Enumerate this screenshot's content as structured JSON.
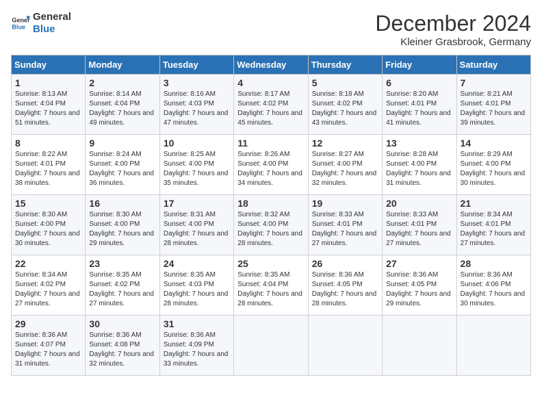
{
  "header": {
    "logo_line1": "General",
    "logo_line2": "Blue",
    "month": "December 2024",
    "location": "Kleiner Grasbrook, Germany"
  },
  "days_of_week": [
    "Sunday",
    "Monday",
    "Tuesday",
    "Wednesday",
    "Thursday",
    "Friday",
    "Saturday"
  ],
  "weeks": [
    [
      {
        "day": "1",
        "info": "Sunrise: 8:13 AM\nSunset: 4:04 PM\nDaylight: 7 hours\nand 51 minutes."
      },
      {
        "day": "2",
        "info": "Sunrise: 8:14 AM\nSunset: 4:04 PM\nDaylight: 7 hours\nand 49 minutes."
      },
      {
        "day": "3",
        "info": "Sunrise: 8:16 AM\nSunset: 4:03 PM\nDaylight: 7 hours\nand 47 minutes."
      },
      {
        "day": "4",
        "info": "Sunrise: 8:17 AM\nSunset: 4:02 PM\nDaylight: 7 hours\nand 45 minutes."
      },
      {
        "day": "5",
        "info": "Sunrise: 8:18 AM\nSunset: 4:02 PM\nDaylight: 7 hours\nand 43 minutes."
      },
      {
        "day": "6",
        "info": "Sunrise: 8:20 AM\nSunset: 4:01 PM\nDaylight: 7 hours\nand 41 minutes."
      },
      {
        "day": "7",
        "info": "Sunrise: 8:21 AM\nSunset: 4:01 PM\nDaylight: 7 hours\nand 39 minutes."
      }
    ],
    [
      {
        "day": "8",
        "info": "Sunrise: 8:22 AM\nSunset: 4:01 PM\nDaylight: 7 hours\nand 38 minutes."
      },
      {
        "day": "9",
        "info": "Sunrise: 8:24 AM\nSunset: 4:00 PM\nDaylight: 7 hours\nand 36 minutes."
      },
      {
        "day": "10",
        "info": "Sunrise: 8:25 AM\nSunset: 4:00 PM\nDaylight: 7 hours\nand 35 minutes."
      },
      {
        "day": "11",
        "info": "Sunrise: 8:26 AM\nSunset: 4:00 PM\nDaylight: 7 hours\nand 34 minutes."
      },
      {
        "day": "12",
        "info": "Sunrise: 8:27 AM\nSunset: 4:00 PM\nDaylight: 7 hours\nand 32 minutes."
      },
      {
        "day": "13",
        "info": "Sunrise: 8:28 AM\nSunset: 4:00 PM\nDaylight: 7 hours\nand 31 minutes."
      },
      {
        "day": "14",
        "info": "Sunrise: 8:29 AM\nSunset: 4:00 PM\nDaylight: 7 hours\nand 30 minutes."
      }
    ],
    [
      {
        "day": "15",
        "info": "Sunrise: 8:30 AM\nSunset: 4:00 PM\nDaylight: 7 hours\nand 30 minutes."
      },
      {
        "day": "16",
        "info": "Sunrise: 8:30 AM\nSunset: 4:00 PM\nDaylight: 7 hours\nand 29 minutes."
      },
      {
        "day": "17",
        "info": "Sunrise: 8:31 AM\nSunset: 4:00 PM\nDaylight: 7 hours\nand 28 minutes."
      },
      {
        "day": "18",
        "info": "Sunrise: 8:32 AM\nSunset: 4:00 PM\nDaylight: 7 hours\nand 28 minutes."
      },
      {
        "day": "19",
        "info": "Sunrise: 8:33 AM\nSunset: 4:01 PM\nDaylight: 7 hours\nand 27 minutes."
      },
      {
        "day": "20",
        "info": "Sunrise: 8:33 AM\nSunset: 4:01 PM\nDaylight: 7 hours\nand 27 minutes."
      },
      {
        "day": "21",
        "info": "Sunrise: 8:34 AM\nSunset: 4:01 PM\nDaylight: 7 hours\nand 27 minutes."
      }
    ],
    [
      {
        "day": "22",
        "info": "Sunrise: 8:34 AM\nSunset: 4:02 PM\nDaylight: 7 hours\nand 27 minutes."
      },
      {
        "day": "23",
        "info": "Sunrise: 8:35 AM\nSunset: 4:02 PM\nDaylight: 7 hours\nand 27 minutes."
      },
      {
        "day": "24",
        "info": "Sunrise: 8:35 AM\nSunset: 4:03 PM\nDaylight: 7 hours\nand 28 minutes."
      },
      {
        "day": "25",
        "info": "Sunrise: 8:35 AM\nSunset: 4:04 PM\nDaylight: 7 hours\nand 28 minutes."
      },
      {
        "day": "26",
        "info": "Sunrise: 8:36 AM\nSunset: 4:05 PM\nDaylight: 7 hours\nand 28 minutes."
      },
      {
        "day": "27",
        "info": "Sunrise: 8:36 AM\nSunset: 4:05 PM\nDaylight: 7 hours\nand 29 minutes."
      },
      {
        "day": "28",
        "info": "Sunrise: 8:36 AM\nSunset: 4:06 PM\nDaylight: 7 hours\nand 30 minutes."
      }
    ],
    [
      {
        "day": "29",
        "info": "Sunrise: 8:36 AM\nSunset: 4:07 PM\nDaylight: 7 hours\nand 31 minutes."
      },
      {
        "day": "30",
        "info": "Sunrise: 8:36 AM\nSunset: 4:08 PM\nDaylight: 7 hours\nand 32 minutes."
      },
      {
        "day": "31",
        "info": "Sunrise: 8:36 AM\nSunset: 4:09 PM\nDaylight: 7 hours\nand 33 minutes."
      },
      {
        "day": "",
        "info": ""
      },
      {
        "day": "",
        "info": ""
      },
      {
        "day": "",
        "info": ""
      },
      {
        "day": "",
        "info": ""
      }
    ]
  ]
}
